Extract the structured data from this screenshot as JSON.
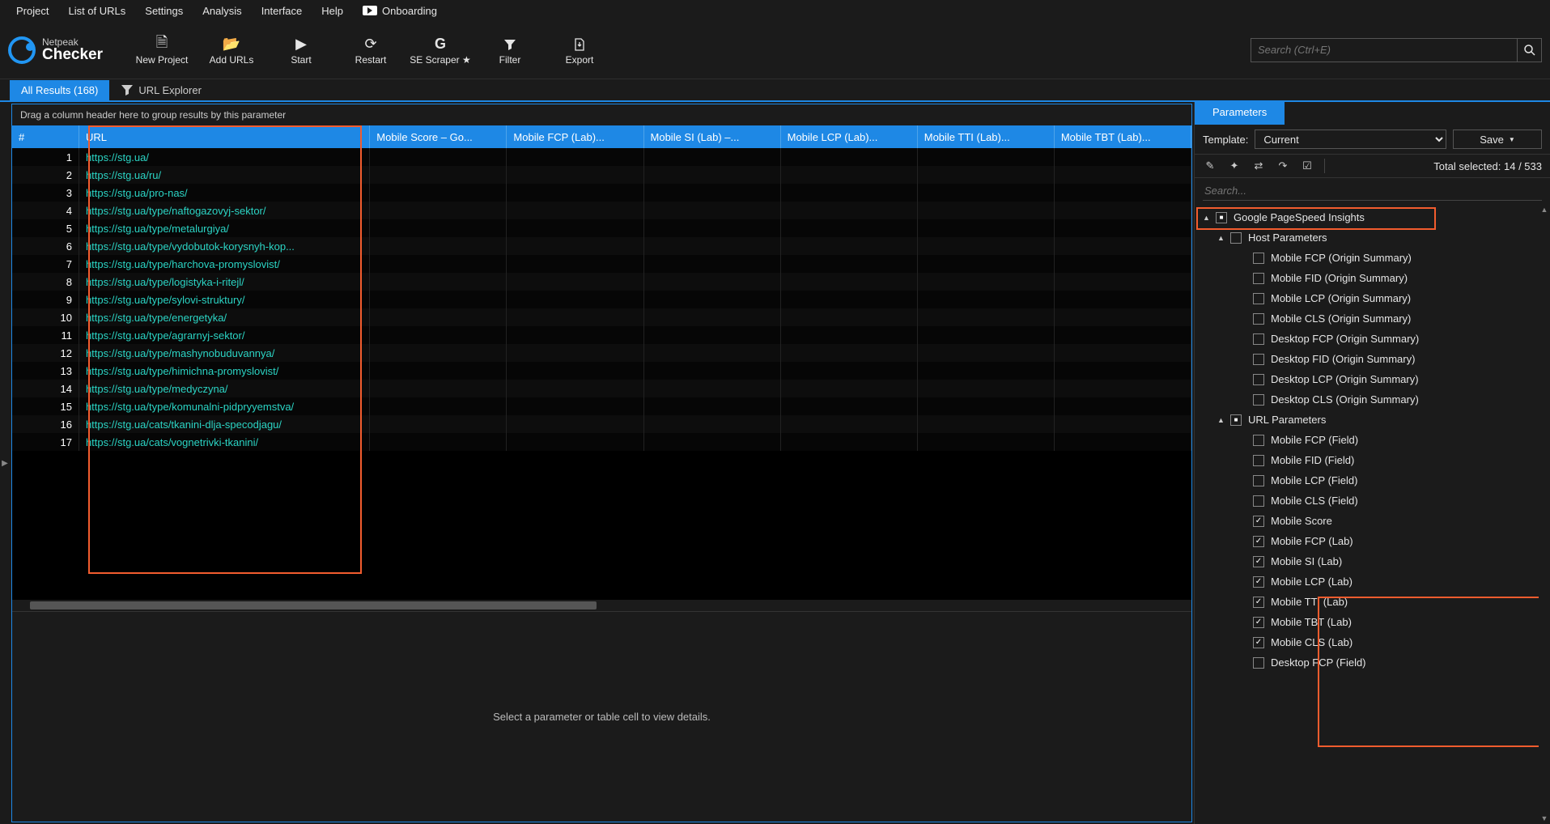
{
  "menu": {
    "project": "Project",
    "list": "List of URLs",
    "settings": "Settings",
    "analysis": "Analysis",
    "interface": "Interface",
    "help": "Help",
    "onboarding": "Onboarding"
  },
  "app": {
    "brand_top": "Netpeak",
    "brand_bottom": "Checker"
  },
  "toolbar": {
    "new_project": "New Project",
    "add_urls": "Add URLs",
    "start": "Start",
    "restart": "Restart",
    "se_scraper": "SE Scraper ★",
    "filter": "Filter",
    "export": "Export"
  },
  "search": {
    "placeholder": "Search (Ctrl+E)"
  },
  "tabs": {
    "all_results": "All Results (168)",
    "url_explorer": "URL Explorer"
  },
  "grid": {
    "group_hint": "Drag a column header here to group results by this parameter",
    "cols": {
      "num": "#",
      "url": "URL",
      "mscore": "Mobile Score  –  Go...",
      "mfcp": "Mobile FCP (Lab)...",
      "msi": "Mobile SI (Lab)  –...",
      "mlcp": "Mobile LCP (Lab)...",
      "mtti": "Mobile TTI (Lab)...",
      "mtbt": "Mobile TBT (Lab)..."
    },
    "rows": [
      {
        "n": 1,
        "url": "https://stg.ua/"
      },
      {
        "n": 2,
        "url": "https://stg.ua/ru/"
      },
      {
        "n": 3,
        "url": "https://stg.ua/pro-nas/"
      },
      {
        "n": 4,
        "url": "https://stg.ua/type/naftogazovyj-sektor/"
      },
      {
        "n": 5,
        "url": "https://stg.ua/type/metalurgiya/"
      },
      {
        "n": 6,
        "url": "https://stg.ua/type/vydobutok-korysnyh-kop..."
      },
      {
        "n": 7,
        "url": "https://stg.ua/type/harchova-promyslovist/"
      },
      {
        "n": 8,
        "url": "https://stg.ua/type/logistyka-i-ritejl/"
      },
      {
        "n": 9,
        "url": "https://stg.ua/type/sylovi-struktury/"
      },
      {
        "n": 10,
        "url": "https://stg.ua/type/energetyka/"
      },
      {
        "n": 11,
        "url": "https://stg.ua/type/agrarnyj-sektor/"
      },
      {
        "n": 12,
        "url": "https://stg.ua/type/mashynobuduvannya/"
      },
      {
        "n": 13,
        "url": "https://stg.ua/type/himichna-promyslovist/"
      },
      {
        "n": 14,
        "url": "https://stg.ua/type/medyczyna/"
      },
      {
        "n": 15,
        "url": "https://stg.ua/type/komunalni-pidpryyemstva/"
      },
      {
        "n": 16,
        "url": "https://stg.ua/cats/tkanini-dlja-specodjagu/"
      },
      {
        "n": 17,
        "url": "https://stg.ua/cats/vognetrivki-tkanini/"
      }
    ]
  },
  "details": {
    "empty": "Select a parameter or table cell to view details."
  },
  "side": {
    "tab": "Parameters",
    "template_label": "Template:",
    "template_value": "Current",
    "save": "Save",
    "total": "Total selected: 14 / 533",
    "search": "Search...",
    "tree": {
      "root": "Google PageSpeed Insights",
      "host": "Host Parameters",
      "host_items": [
        "Mobile FCP (Origin Summary)",
        "Mobile FID (Origin Summary)",
        "Mobile LCP (Origin Summary)",
        "Mobile CLS (Origin Summary)",
        "Desktop FCP (Origin Summary)",
        "Desktop FID (Origin Summary)",
        "Desktop LCP (Origin Summary)",
        "Desktop CLS (Origin Summary)"
      ],
      "url": "URL Parameters",
      "url_field": [
        "Mobile FCP (Field)",
        "Mobile FID (Field)",
        "Mobile LCP (Field)",
        "Mobile CLS (Field)"
      ],
      "url_lab": [
        "Mobile Score",
        "Mobile FCP (Lab)",
        "Mobile SI (Lab)",
        "Mobile LCP (Lab)",
        "Mobile TTI (Lab)",
        "Mobile TBT (Lab)",
        "Mobile CLS (Lab)"
      ],
      "url_tail": [
        "Desktop FCP (Field)"
      ]
    }
  }
}
